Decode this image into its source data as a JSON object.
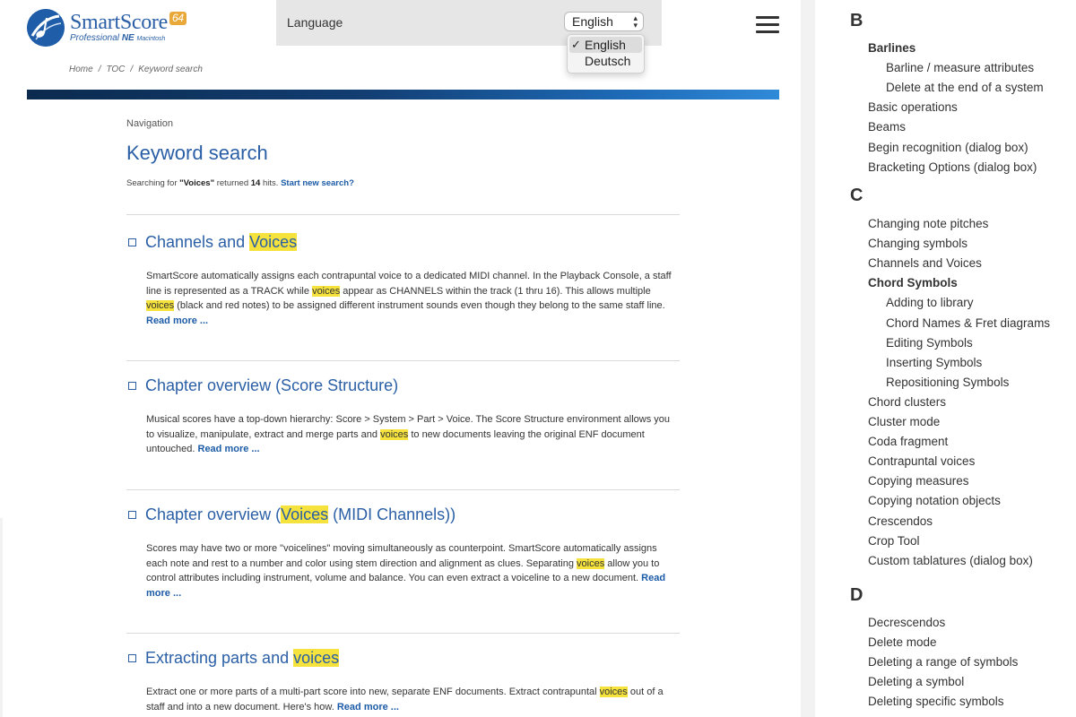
{
  "logo": {
    "name": "SmartScore",
    "badge": "64",
    "edition": "Professional",
    "edition_ne": "NE",
    "platform": "Macintosh"
  },
  "language": {
    "label": "Language",
    "selected": "English",
    "options": [
      "English",
      "Deutsch"
    ]
  },
  "breadcrumb": [
    "Home",
    "TOC",
    "Keyword search"
  ],
  "main": {
    "nav_label": "Navigation",
    "title": "Keyword search",
    "search_prefix": "Searching for",
    "search_term": "\"Voices\"",
    "search_middle": "returned",
    "hit_count": "14",
    "search_suffix": "hits.",
    "new_search": "Start new search?",
    "read_more": "Read more ...",
    "results": [
      {
        "title_parts": [
          {
            "t": "Channels and "
          },
          {
            "t": "Voices",
            "hl": true
          }
        ],
        "body_parts": [
          {
            "t": "SmartScore automatically assigns each contrapuntal voice to a dedicated MIDI channel. In the Playback Console, a staff line is represented as a TRACK while "
          },
          {
            "t": "voices",
            "hl": true
          },
          {
            "t": " appear as CHANNELS within the track (1 thru 16). This allows multiple "
          },
          {
            "t": "voices",
            "hl": true
          },
          {
            "t": " (black and red notes) to be assigned different instrument sounds even though they belong to the same staff line. "
          }
        ]
      },
      {
        "title_parts": [
          {
            "t": "Chapter overview (Score Structure)"
          }
        ],
        "body_parts": [
          {
            "t": "Musical scores have a top-down hierarchy: Score > System > Part > Voice. The Score Structure environment allows you to visualize, manipulate, extract and merge parts and "
          },
          {
            "t": "voices",
            "hl": true
          },
          {
            "t": " to new documents leaving the original ENF document untouched. "
          }
        ]
      },
      {
        "title_parts": [
          {
            "t": "Chapter overview ("
          },
          {
            "t": "Voices",
            "hl": true
          },
          {
            "t": " (MIDI Channels))"
          }
        ],
        "body_parts": [
          {
            "t": "Scores may have two or more \"voicelines\" moving simultaneously as counterpoint. SmartScore automatically assigns each note and rest to a number and color using stem direction and alignment as clues. Separating "
          },
          {
            "t": "voices",
            "hl": true
          },
          {
            "t": " allow you to control attributes including instrument, volume and balance. You can even extract a voiceline to a new document. "
          }
        ]
      },
      {
        "title_parts": [
          {
            "t": "Extracting parts and "
          },
          {
            "t": "voices",
            "hl": true
          }
        ],
        "body_parts": [
          {
            "t": "Extract one or more parts of a multi-part score into new, separate ENF documents. Extract contrapuntal "
          },
          {
            "t": "voices",
            "hl": true
          },
          {
            "t": " out of a staff and into a new document. Here's how. "
          }
        ]
      }
    ]
  },
  "index": {
    "letters": [
      "B",
      "C",
      "D"
    ],
    "B": [
      {
        "label": "Barlines",
        "level": 1,
        "bold": true
      },
      {
        "label": "Barline / measure attributes",
        "level": 2
      },
      {
        "label": "Delete at the end of a system",
        "level": 2
      },
      {
        "label": "Basic operations",
        "level": 1
      },
      {
        "label": "Beams",
        "level": 1
      },
      {
        "label": "Begin recognition (dialog box)",
        "level": 1
      },
      {
        "label": "Bracketing Options (dialog box)",
        "level": 1
      }
    ],
    "C": [
      {
        "label": "Changing note pitches",
        "level": 1
      },
      {
        "label": "Changing symbols",
        "level": 1
      },
      {
        "label": "Channels and Voices",
        "level": 1
      },
      {
        "label": "Chord Symbols",
        "level": 1,
        "bold": true
      },
      {
        "label": "Adding to library",
        "level": 2
      },
      {
        "label": "Chord Names & Fret diagrams",
        "level": 2
      },
      {
        "label": "Editing Symbols",
        "level": 2
      },
      {
        "label": "Inserting Symbols",
        "level": 2
      },
      {
        "label": "Repositioning Symbols",
        "level": 2
      },
      {
        "label": "Chord clusters",
        "level": 1
      },
      {
        "label": "Cluster mode",
        "level": 1
      },
      {
        "label": "Coda fragment",
        "level": 1
      },
      {
        "label": "Contrapuntal voices",
        "level": 1
      },
      {
        "label": "Copying measures",
        "level": 1
      },
      {
        "label": "Copying notation objects",
        "level": 1
      },
      {
        "label": "Crescendos",
        "level": 1
      },
      {
        "label": "Crop Tool",
        "level": 1
      },
      {
        "label": "Custom tablatures (dialog box)",
        "level": 1
      }
    ],
    "D": [
      {
        "label": "Decrescendos",
        "level": 1
      },
      {
        "label": "Delete mode",
        "level": 1
      },
      {
        "label": "Deleting a range of symbols",
        "level": 1
      },
      {
        "label": "Deleting a symbol",
        "level": 1
      },
      {
        "label": "Deleting specific symbols",
        "level": 1
      }
    ]
  },
  "colors": {
    "link": "#2a5fa6",
    "highlight": "#f5e23d",
    "hero_dark": "#0b2a4e",
    "hero_light": "#2f8ad8",
    "logo_badge": "#e9a93a"
  }
}
